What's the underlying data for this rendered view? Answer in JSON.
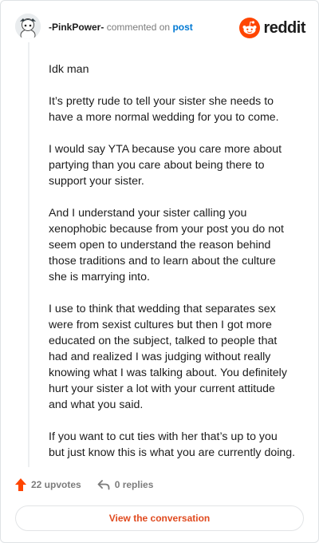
{
  "comment": {
    "username": "-PinkPower-",
    "verb": "commented on",
    "link_text": "post",
    "paragraphs": [
      "Idk man",
      "It’s pretty rude to tell your sister she needs to have a more normal wedding for you to come.",
      "I would say YTA because you care more about partying than you care about being there to support your sister.",
      "And I understand your sister calling you xenophobic because from your post you do not seem open to understand the reason behind those traditions and to learn about the culture she is marrying into.",
      "I use to think that wedding that separates sex were from sexist cultures but then I got more educated on the subject, talked to people that had and realized I was judging without really knowing what I was talking about. You definitely hurt your sister a lot with your current attitude and what you said.",
      "If you want to cut ties with her that’s up to you but just know this is what you are currently doing."
    ]
  },
  "brand": {
    "wordmark": "reddit",
    "logo_icon": "reddit-snoo-icon",
    "color": "#ff4500"
  },
  "footer": {
    "upvotes": "22 upvotes",
    "replies": "0 replies",
    "cta": "View the conversation"
  },
  "colors": {
    "accent": "#ff4500",
    "link": "#0079d3",
    "muted": "#7c7c7c"
  }
}
